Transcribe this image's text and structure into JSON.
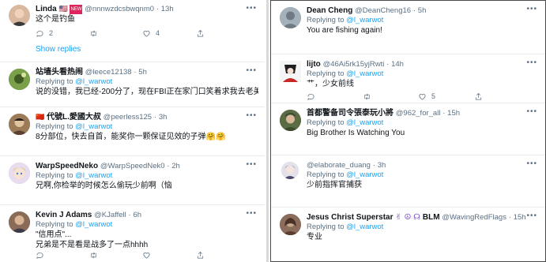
{
  "left": {
    "tweets": [
      {
        "name": "Linda",
        "flag": "🇺🇸",
        "badge": "NEW",
        "handle": "@nnnwzdcsbwqnm0",
        "time": "13h",
        "replying_prefix": "",
        "replying_to": "",
        "text": [
          "这个是钓鱼"
        ],
        "reply_count": "2",
        "retweet_count": "",
        "like_count": "4",
        "avatar_color": "#d9b8a0"
      },
      {
        "name": "站墙头看热闹",
        "handle": "@leece12138",
        "time": "5h",
        "replying_prefix": "Replying to",
        "replying_to": "@l_warwot",
        "text": [
          "说的没错，我已经-200分了，现在FBI正在家门口笑着求我去老美那边避难。"
        ],
        "reply_count": "",
        "retweet_count": "",
        "like_count": "",
        "avatar_color": "#6b8f3a"
      },
      {
        "name": "代號L.愛國大叔",
        "flag": "🇨🇳",
        "handle": "@peerless125",
        "time": "3h",
        "replying_prefix": "Replying to",
        "replying_to": "@l_warwot",
        "text": [
          "8分部位，快去自首，能奖你一颗保证见效的子弹🤗🤗"
        ],
        "reply_count": "",
        "retweet_count": "",
        "like_count": "",
        "avatar_color": "#8a6a4a"
      },
      {
        "name": "WarpSpeedNeko",
        "handle": "@WarpSpeedNek0",
        "time": "2h",
        "replying_prefix": "Replying to",
        "replying_to": "@l_warwot",
        "text": [
          "兄啊,你检举的时候怎么偷玩少前啊（恼"
        ],
        "reply_count": "",
        "retweet_count": "",
        "like_count": "",
        "avatar_color": "#b7a3c9"
      },
      {
        "name": "Kevin J Adams",
        "handle": "@KJaffell",
        "time": "6h",
        "replying_prefix": "Replying to",
        "replying_to": "@l_warwot",
        "text": [
          "\"信用点\"...",
          "兄弟是不是看是战多了一点hhhh"
        ],
        "reply_count": "",
        "retweet_count": "",
        "like_count": "",
        "avatar_color": "#7a5c4a"
      }
    ],
    "show_replies": "Show replies"
  },
  "right": {
    "tweets": [
      {
        "name": "Dean Cheng",
        "handle": "@DeanCheng16",
        "time": "5h",
        "replying_prefix": "Replying to",
        "replying_to": "@l_warwot",
        "text": [
          "You are fishing again!"
        ],
        "reply_count": "",
        "retweet_count": "",
        "like_count": "",
        "avatar_color": "#8c9aa5"
      },
      {
        "name": "lijto",
        "handle": "@46Ai5rk15yjRwti",
        "time": "14h",
        "replying_prefix": "Replying to",
        "replying_to": "@l_warwot",
        "text": [
          "艹，少女前线"
        ],
        "reply_count": "",
        "retweet_count": "",
        "like_count": "5",
        "avatar_color": "#2d2d2d"
      },
      {
        "name": "首都警备司令張泰玩小將",
        "handle": "@962_for_all",
        "time": "15h",
        "replying_prefix": "Replying to",
        "replying_to": "@l_warwot",
        "text": [
          "Big Brother Is Watching You"
        ],
        "reply_count": "",
        "retweet_count": "",
        "like_count": "",
        "avatar_color": "#4b5a3a"
      },
      {
        "name": "",
        "handle": "@elaborate_duang",
        "time": "3h",
        "replying_prefix": "Replying to",
        "replying_to": "@l_warwot",
        "text": [
          "少前指挥官捕获"
        ],
        "reply_count": "",
        "retweet_count": "",
        "like_count": "",
        "avatar_color": "#c4c4d0"
      },
      {
        "name": "Jesus Christ Superstar",
        "emoji": "✌ ☮ ☊",
        "name_suffix": "BLM",
        "handle": "@WavingRedFlags",
        "time": "15h",
        "replying_prefix": "Replying to",
        "replying_to": "@l_warwot",
        "text": [
          "专业"
        ],
        "reply_count": "",
        "retweet_count": "",
        "like_count": "",
        "avatar_color": "#7a5f50"
      }
    ]
  },
  "more_icon": "more-icon",
  "accent": "#1da1f2",
  "secondary": "#5b7083"
}
